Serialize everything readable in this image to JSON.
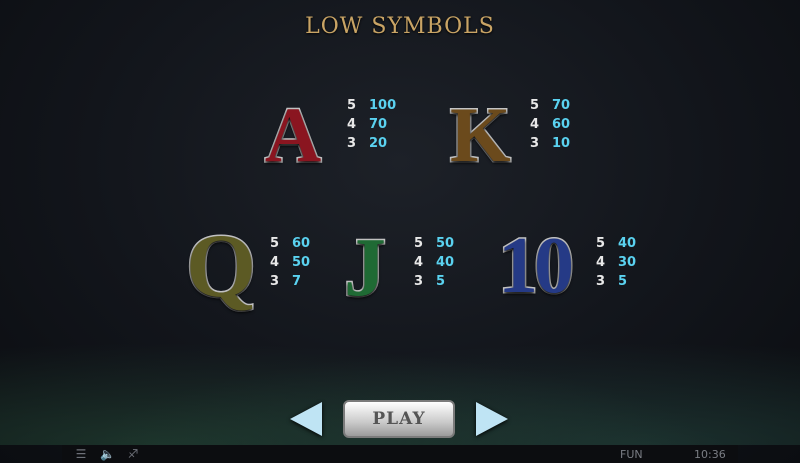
{
  "title": "LOW SYMBOLS",
  "symbols": [
    {
      "glyph": "A",
      "color": "#8a1520",
      "pays": [
        {
          "count": "5",
          "value": "100"
        },
        {
          "count": "4",
          "value": "70"
        },
        {
          "count": "3",
          "value": "20"
        }
      ]
    },
    {
      "glyph": "K",
      "color": "#6b4a1c",
      "pays": [
        {
          "count": "5",
          "value": "70"
        },
        {
          "count": "4",
          "value": "60"
        },
        {
          "count": "3",
          "value": "10"
        }
      ]
    },
    {
      "glyph": "Q",
      "color": "#5c5a24",
      "pays": [
        {
          "count": "5",
          "value": "60"
        },
        {
          "count": "4",
          "value": "50"
        },
        {
          "count": "3",
          "value": "7"
        }
      ]
    },
    {
      "glyph": "J",
      "color": "#1f6a34",
      "pays": [
        {
          "count": "5",
          "value": "50"
        },
        {
          "count": "4",
          "value": "40"
        },
        {
          "count": "3",
          "value": "5"
        }
      ]
    },
    {
      "glyph": "10",
      "color": "#253a86",
      "pays": [
        {
          "count": "5",
          "value": "40"
        },
        {
          "count": "4",
          "value": "30"
        },
        {
          "count": "3",
          "value": "5"
        }
      ]
    }
  ],
  "play_label": "PLAY",
  "bottom_bar": {
    "menu_icon": "menu-icon",
    "sound_icon": "speaker-icon",
    "turbo_icon": "turbo-icon",
    "mode": "FUN",
    "time": "10:36"
  }
}
